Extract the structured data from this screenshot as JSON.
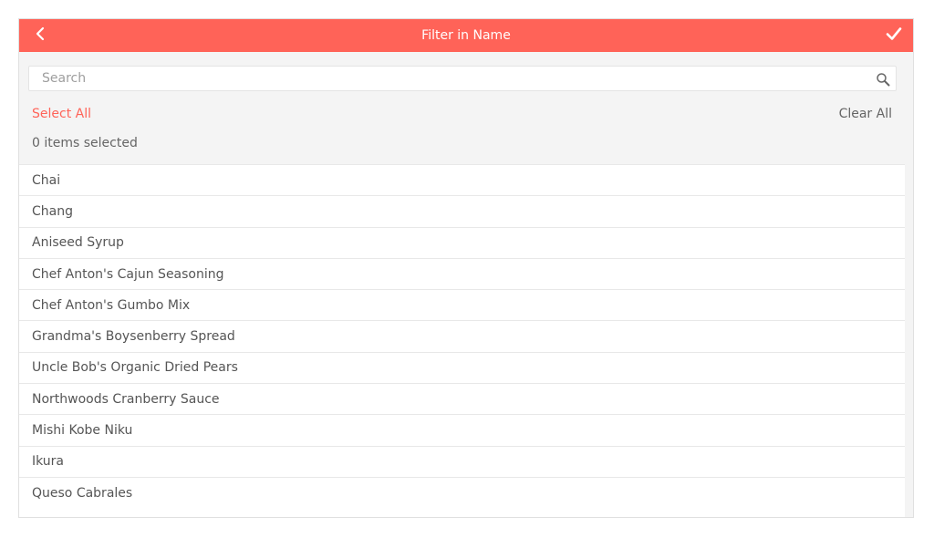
{
  "header": {
    "title": "Filter in Name",
    "back_icon": "chevron-left-icon",
    "done_icon": "checkmark-icon",
    "accent_color": "#ff6358"
  },
  "search": {
    "placeholder": "Search",
    "value": "",
    "icon": "search-icon"
  },
  "actions": {
    "select_all": "Select All",
    "clear_all": "Clear All"
  },
  "selection": {
    "count_text": "0 items selected"
  },
  "items": [
    "Chai",
    "Chang",
    "Aniseed Syrup",
    "Chef Anton's Cajun Seasoning",
    "Chef Anton's Gumbo Mix",
    "Grandma's Boysenberry Spread",
    "Uncle Bob's Organic Dried Pears",
    "Northwoods Cranberry Sauce",
    "Mishi Kobe Niku",
    "Ikura",
    "Queso Cabrales"
  ]
}
